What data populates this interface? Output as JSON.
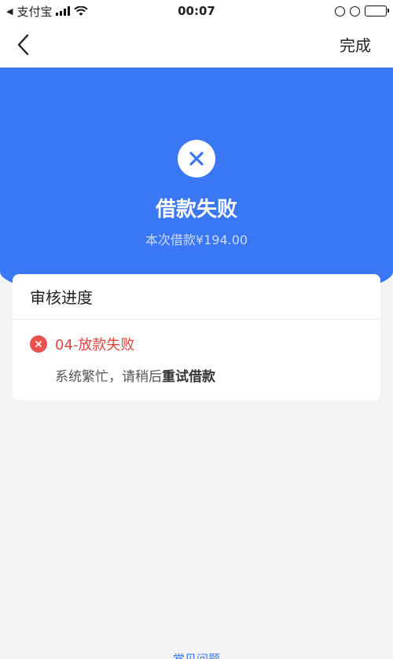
{
  "status_bar": {
    "back_app": "支付宝",
    "time": "00:07"
  },
  "nav": {
    "done_label": "完成"
  },
  "hero": {
    "title": "借款失败",
    "subtitle": "本次借款¥194.00"
  },
  "progress_card": {
    "title": "审核进度",
    "step_title": "04-放款失败",
    "step_desc_prefix": "系统繁忙，请稍后",
    "step_desc_action": "重试借款"
  },
  "footer": {
    "faq_label": "常见问题"
  },
  "colors": {
    "primary": "#3a77f5",
    "error": "#e0443e",
    "background": "#f4f4f5"
  }
}
